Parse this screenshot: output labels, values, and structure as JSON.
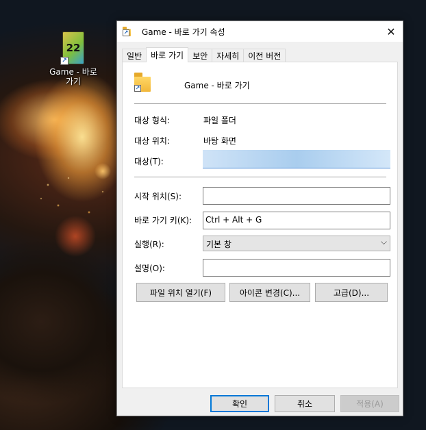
{
  "desktop": {
    "icon_label": "Game - 바로 가기",
    "icon_text": "22"
  },
  "dialog": {
    "title": "Game - 바로 가기 속성",
    "close_glyph": "✕",
    "tabs": [
      {
        "label": "일반",
        "active": false
      },
      {
        "label": "바로 가기",
        "active": true
      },
      {
        "label": "보안",
        "active": false
      },
      {
        "label": "자세히",
        "active": false
      },
      {
        "label": "이전 버전",
        "active": false
      }
    ],
    "shortcut_name": "Game - 바로 가기",
    "fields": {
      "target_type_label": "대상 형식:",
      "target_type_value": "파일 폴더",
      "target_location_label": "대상 위치:",
      "target_location_value": "바탕 화면",
      "target_label": "대상(T):",
      "target_value": "",
      "start_in_label": "시작 위치(S):",
      "start_in_value": "",
      "shortcut_key_label": "바로 가기 키(K):",
      "shortcut_key_value": "Ctrl + Alt + G",
      "run_label": "실행(R):",
      "run_value": "기본 창",
      "comment_label": "설명(O):",
      "comment_value": ""
    },
    "action_buttons": {
      "open_location": "파일 위치 열기(F)",
      "change_icon": "아이콘 변경(C)...",
      "advanced": "고급(D)..."
    },
    "footer_buttons": {
      "ok": "확인",
      "cancel": "취소",
      "apply": "적용(A)"
    },
    "colors": {
      "accent": "#0078d7",
      "panel_bg": "#ffffff",
      "window_bg": "#f0f0f0"
    }
  }
}
